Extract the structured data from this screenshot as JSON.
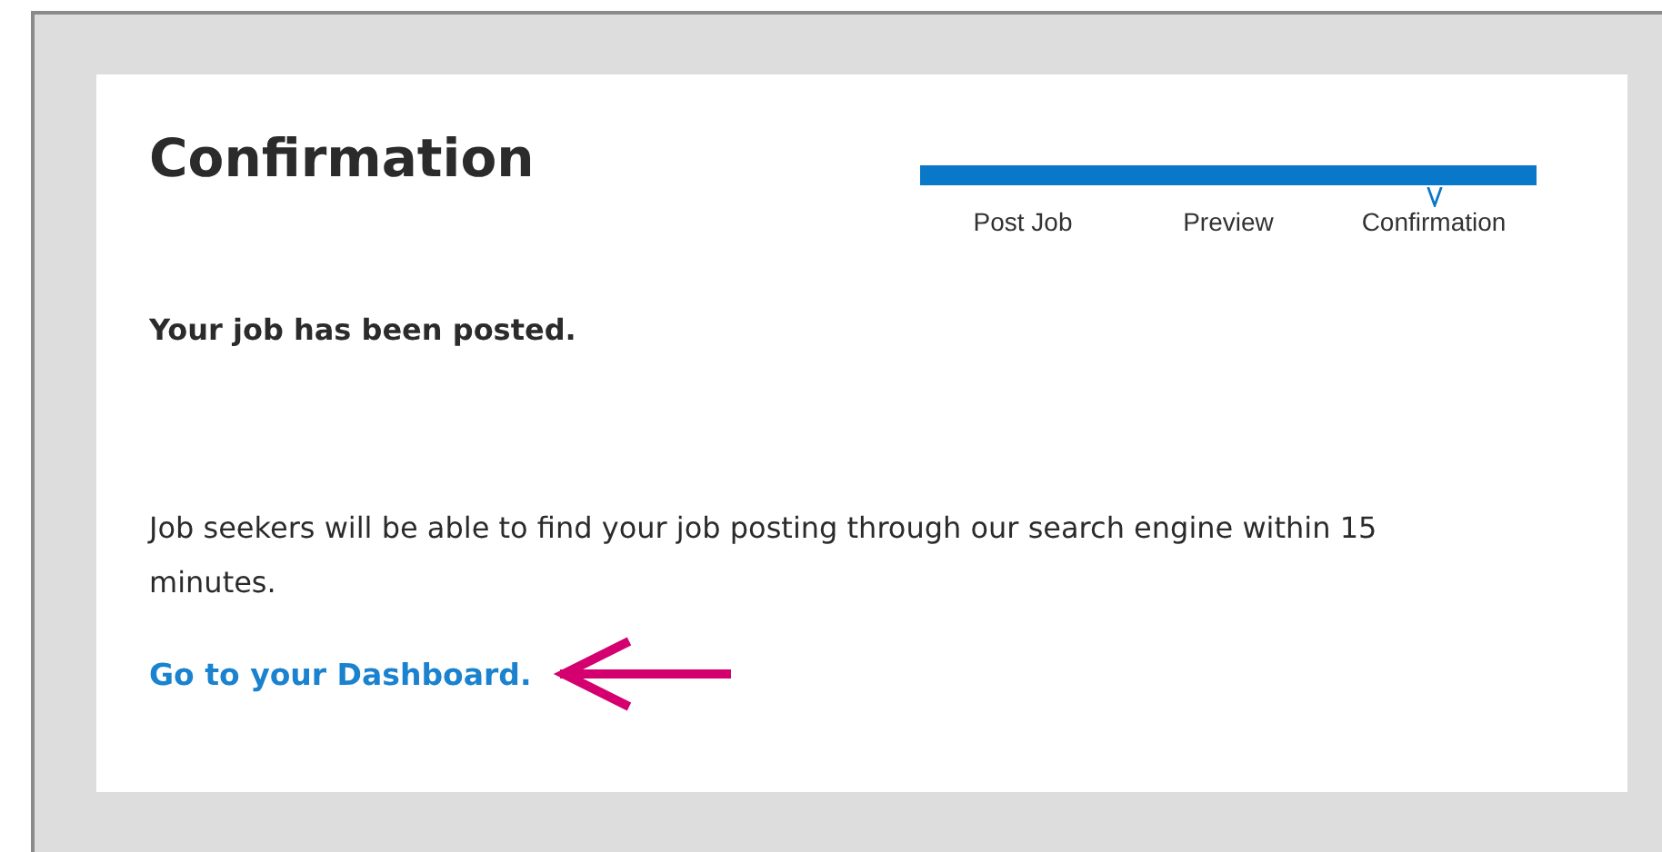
{
  "title": "Confirmation",
  "progress": {
    "level": 1
  },
  "steps": [
    {
      "label": "Post Job",
      "selected": false
    },
    {
      "label": "Preview",
      "selected": false
    },
    {
      "label": "Confirmation",
      "selected": true
    }
  ],
  "status": "Your job has been posted.",
  "message": "Job seekers will be able to find your job posting through our search engine within 15 minutes.",
  "link": "Go to your Dashboard."
}
